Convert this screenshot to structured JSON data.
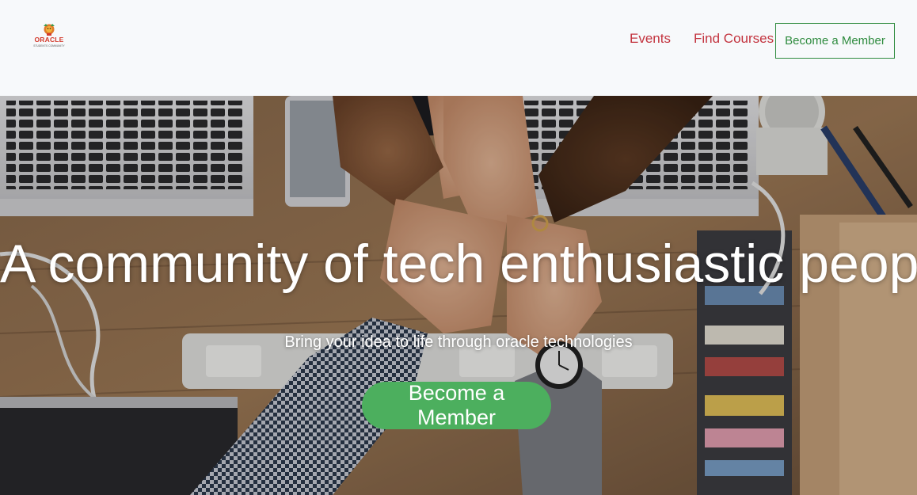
{
  "nav": {
    "logo": {
      "icon": "oracle-community-logo",
      "text": "ORACLE",
      "subtext": "STUDENTS COMMUNITY"
    },
    "links": [
      {
        "label": "Events"
      },
      {
        "label": "Find Courses"
      }
    ],
    "cta_label": "Become a Member"
  },
  "hero": {
    "title": "A community of tech enthusiastic people",
    "subtitle": "Bring your idea to life through oracle technologies",
    "cta_label": "Become a Member"
  },
  "colors": {
    "nav_link": "#c3343f",
    "nav_button_border": "#2e8b3e",
    "hero_button": "#4caf5e",
    "page_background": "#f7f9fb"
  }
}
